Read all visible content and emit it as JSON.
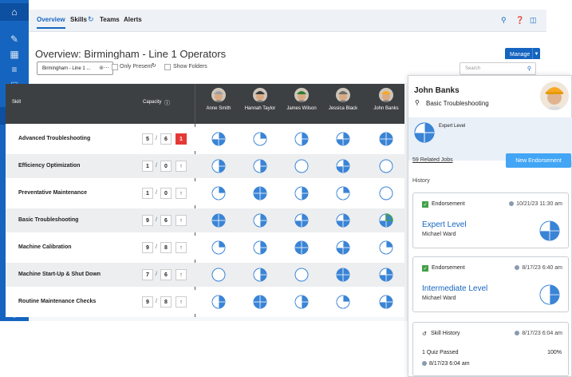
{
  "nav": {
    "tabs": [
      "Overview",
      "Skills",
      "Teams",
      "Alerts"
    ],
    "active_tab": "Overview"
  },
  "page": {
    "title": "Overview: Birmingham - Line 1 Operators",
    "manage_label": "Manage"
  },
  "filters": {
    "group_select": "Birmingham - Line 1 ...",
    "only_present": "Only Present",
    "show_folders": "Show Folders",
    "search_placeholder": "Search"
  },
  "grid": {
    "skill_header": "Skill",
    "capacity_header": "Capacity",
    "people": [
      {
        "name": "Anne Smith",
        "helmet": "#9e9e9e"
      },
      {
        "name": "Hannah Taylor",
        "helmet": "#3a3a3a"
      },
      {
        "name": "James Wilson",
        "helmet": "#2e7d32"
      },
      {
        "name": "Jessica Black",
        "helmet": "#6d6d6d"
      },
      {
        "name": "John Banks",
        "helmet": "#f9a825"
      }
    ],
    "rows": [
      {
        "skill": "Advanced Troubleshooting",
        "have": "5",
        "need": "6",
        "badge": "1",
        "levels": [
          3,
          1,
          2,
          3,
          4
        ]
      },
      {
        "skill": "Efficiency Optimization",
        "have": "1",
        "need": "0",
        "badge": "↑",
        "levels": [
          2,
          2,
          0,
          3,
          0
        ]
      },
      {
        "skill": "Preventative Maintenance",
        "have": "1",
        "need": "0",
        "badge": "↑",
        "levels": [
          1,
          4,
          2,
          1,
          0
        ]
      },
      {
        "skill": "Basic Troubleshooting",
        "have": "9",
        "need": "6",
        "badge": "↑",
        "levels": [
          4,
          2,
          3,
          3,
          3
        ]
      },
      {
        "skill": "Machine Calibration",
        "have": "9",
        "need": "8",
        "badge": "↑",
        "levels": [
          1,
          2,
          4,
          3,
          1
        ]
      },
      {
        "skill": "Machine Start-Up & Shut Down",
        "have": "7",
        "need": "6",
        "badge": "↑",
        "levels": [
          0,
          2,
          0,
          4,
          3
        ]
      },
      {
        "skill": "Routine Maintenance Checks",
        "have": "9",
        "need": "8",
        "badge": "↑",
        "levels": [
          2,
          4,
          2,
          1,
          3
        ]
      }
    ],
    "partial_level_note": "John Banks / Basic Troubleshooting shows a green in-progress ring"
  },
  "panel": {
    "name": "John Banks",
    "skill": "Basic Troubleshooting",
    "current_level": "Expert Level",
    "related_jobs": "59 Related Jobs",
    "new_endorsement": "New Endorsement",
    "history_label": "History",
    "cards": [
      {
        "type": "Endorsement",
        "date": "10/21/23 11:30 am",
        "level": "Expert Level",
        "by": "Michael Ward",
        "fill": 3
      },
      {
        "type": "Endorsement",
        "date": "8/17/23 6:40 am",
        "level": "Intermediate Level",
        "by": "Michael Ward",
        "fill": 2
      }
    ],
    "skill_history": {
      "label": "Skill History",
      "date": "8/17/23 6:04 am",
      "item": "1 Quiz Passed",
      "percent": "100%",
      "item_date": "8/17/23 6:04 am"
    }
  },
  "colors": {
    "brand": "#1565c0",
    "pie_fill": "#3a84d6",
    "accent_red": "#e53935",
    "light_blue": "#42a5f5"
  }
}
